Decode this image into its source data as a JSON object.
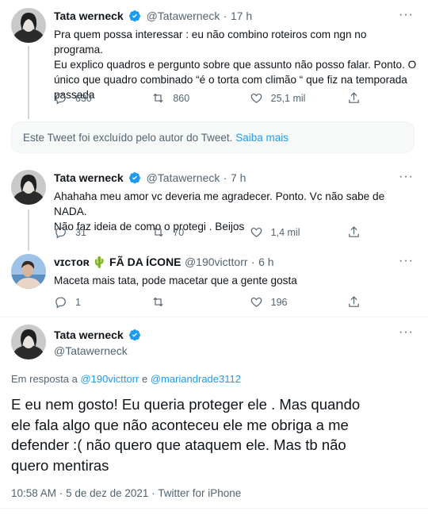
{
  "tweets": [
    {
      "name": "Tata werneck",
      "handle": "@Tatawerneck",
      "time": "17 h",
      "lines": [
        "Pra quem possa interessar : eu não combino roteiros com ngn no programa.",
        "Eu explico quadros e pergunto sobre que assunto não posso falar. Ponto. O",
        "único que quadro combinado “é o torta com climão “ que fiz na temporada",
        "passada"
      ],
      "replies": "630",
      "retweets": "860",
      "likes": "25,1 mil"
    },
    {
      "name": "Tata werneck",
      "handle": "@Tatawerneck",
      "time": "7 h",
      "lines": [
        "Ahahaha meu amor vc deveria me agradecer. Ponto. Vc não sabe de NADA.",
        "Não faz ideia de como o protegi . Beijos"
      ],
      "replies": "31",
      "retweets": "70",
      "likes": "1,4 mil"
    },
    {
      "name": "ᴠɪᴄᴛᴏʀ 🌵 FÃ DA ÍCONE",
      "handle": "@190victtorr",
      "time": "6 h",
      "lines": [
        "Maceta mais tata, pode macetar que a gente gosta"
      ],
      "replies": "1",
      "retweets": "",
      "likes": "196"
    }
  ],
  "deleted": {
    "text": "Este Tweet foi excluído pelo autor do Tweet.",
    "link": "Saiba mais"
  },
  "main": {
    "name": "Tata werneck",
    "handle": "@Tatawerneck",
    "reply_prefix": "Em resposta a",
    "reply_to_1": "@190victtorr",
    "reply_and": "e",
    "reply_to_2": "@mariandrade3112",
    "lines": [
      "E eu nem gosto! Eu queria proteger ele . Mas quando",
      "ele fala algo que não aconteceu ele me obriga a me",
      "defender :( não quero que ataquem ele. Mas tb não",
      "quero mentiras"
    ],
    "time": "10:58 AM",
    "date": "5 de dez de 2021",
    "source": "Twitter for iPhone"
  },
  "colors": {
    "accent": "#1d9bf0",
    "muted": "#536471",
    "verified": "#1d9bf0"
  }
}
